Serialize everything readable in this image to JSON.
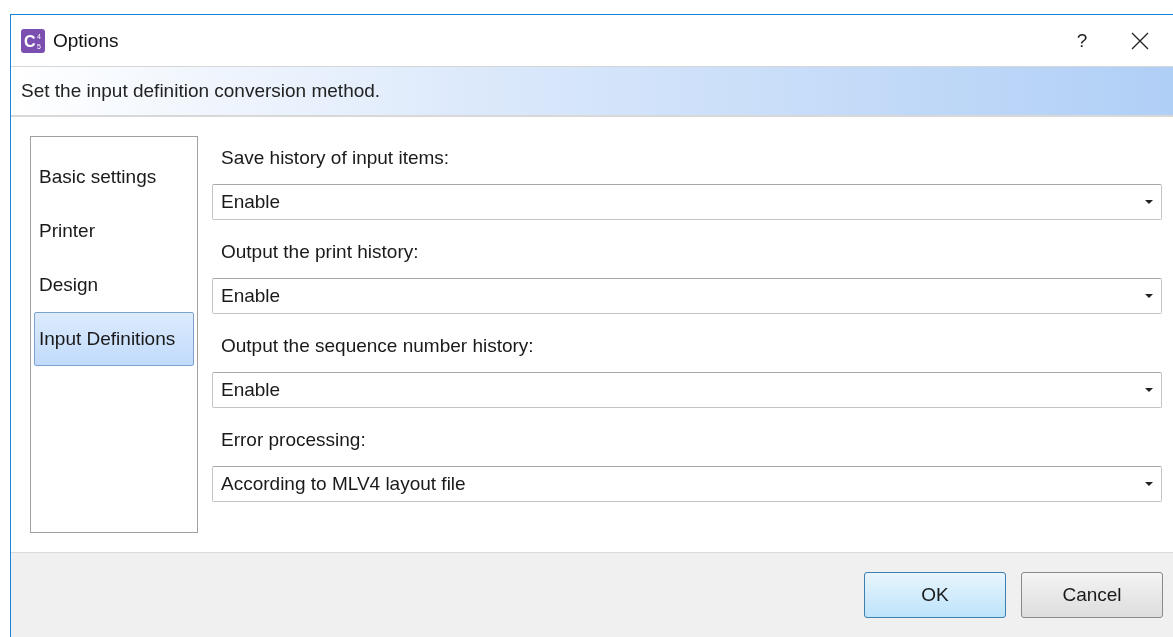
{
  "window": {
    "title": "Options",
    "app_icon": {
      "letter": "C",
      "digits": [
        "4",
        "5"
      ]
    },
    "help": "?"
  },
  "banner": "Set the input definition conversion method.",
  "sidebar": {
    "items": [
      {
        "label": "Basic settings",
        "selected": false
      },
      {
        "label": "Printer",
        "selected": false
      },
      {
        "label": "Design",
        "selected": false
      },
      {
        "label": "Input Definitions",
        "selected": true
      }
    ]
  },
  "settings": [
    {
      "label": "Save history of input items:",
      "value": "Enable"
    },
    {
      "label": "Output the print history:",
      "value": "Enable"
    },
    {
      "label": "Output the sequence number history:",
      "value": "Enable"
    },
    {
      "label": "Error processing:",
      "value": "According to MLV4 layout file"
    }
  ],
  "buttons": [
    {
      "label": "OK",
      "kind": "default"
    },
    {
      "label": "Cancel",
      "kind": "normal"
    }
  ]
}
